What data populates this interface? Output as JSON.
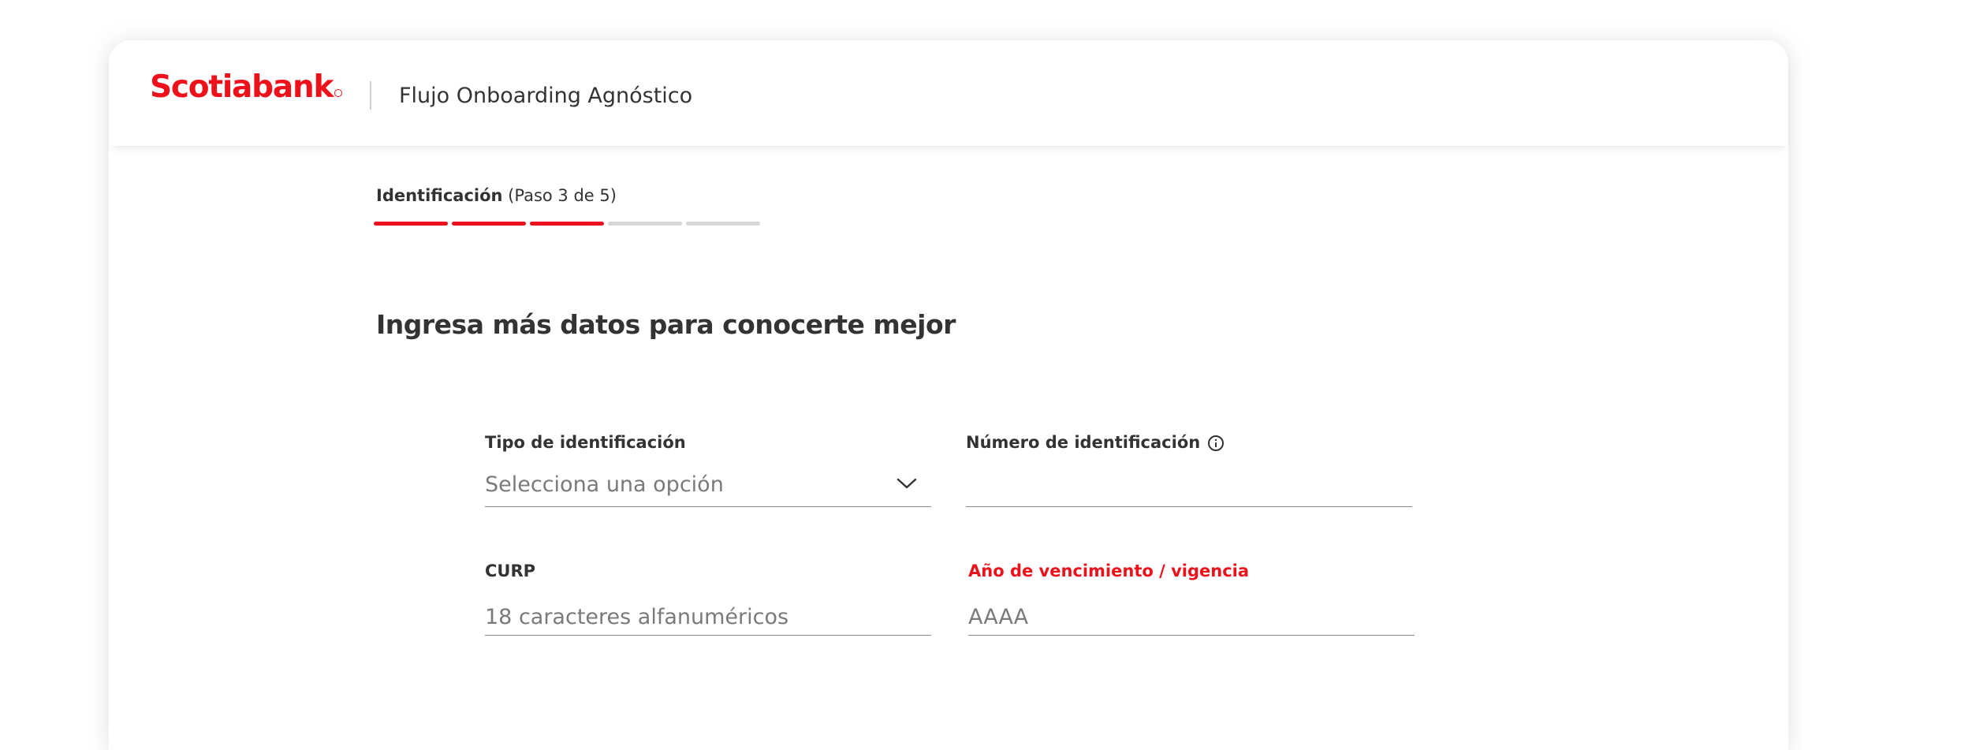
{
  "header": {
    "logo_text": "Scotiabank",
    "subtitle": "Flujo Onboarding Agnóstico"
  },
  "step": {
    "name": "Identificación",
    "detail": "(Paso 3 de 5)",
    "current": 3,
    "total": 5
  },
  "form": {
    "title": "Ingresa más datos para conocerte mejor",
    "fields": {
      "tipo_identificacion": {
        "label": "Tipo de identificación",
        "selected": "Selecciona una opción",
        "icon": "chevron-down-icon"
      },
      "numero_identificacion": {
        "label": "Número de identificación",
        "value": "",
        "icon": "info-icon"
      },
      "curp": {
        "label": "CURP",
        "placeholder": "18 caracteres alfanuméricos"
      },
      "anio_vencimiento": {
        "label": "Año de vencimiento / vigencia",
        "placeholder": "AAAA"
      }
    }
  },
  "colors": {
    "brand_red": "#ec111a",
    "progress_inactive": "#d6d6d6",
    "text": "#333333"
  }
}
